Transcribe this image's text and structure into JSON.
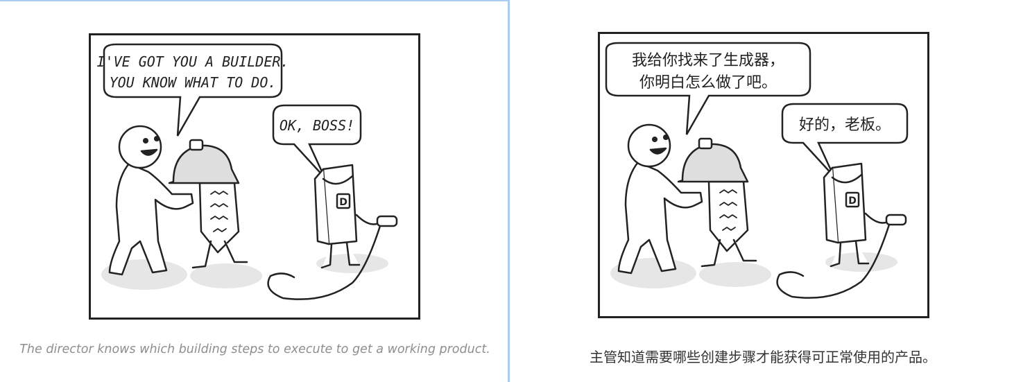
{
  "left": {
    "bubble_director_line1": "I'VE GOT YOU A BUILDER.",
    "bubble_director_line2": "YOU KNOW WHAT TO DO.",
    "bubble_builder": "OK, BOSS!",
    "badge_letter": "D",
    "caption": "The director knows which building steps to execute to get a working product."
  },
  "right": {
    "bubble_director_line1": "我给你找来了生成器，",
    "bubble_director_line2": "你明白怎么做了吧。",
    "bubble_builder": "好的，老板。",
    "badge_letter": "D",
    "caption": "主管知道需要哪些创建步骤才能获得可正常使用的产品。"
  }
}
